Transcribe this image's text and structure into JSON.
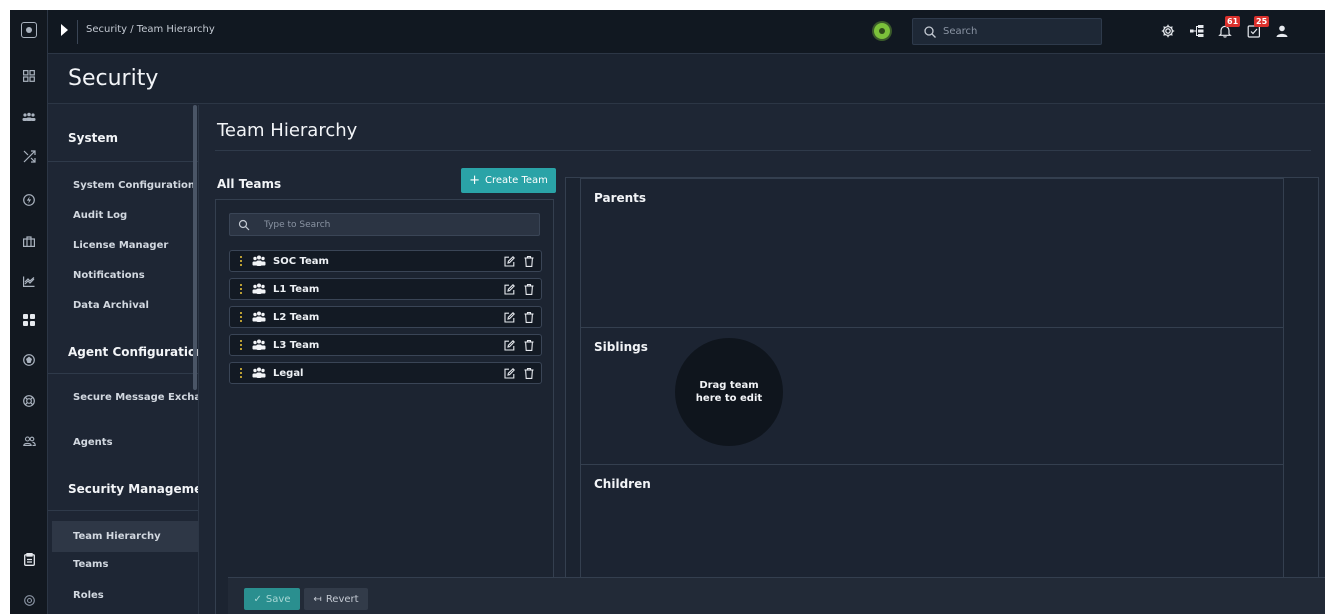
{
  "breadcrumb": {
    "text": "Security / Team Hierarchy"
  },
  "topbar": {
    "search_placeholder": "Search",
    "notifications_count": "61",
    "tasks_count": "25"
  },
  "page": {
    "title": "Security"
  },
  "sidebar": {
    "sections": [
      {
        "heading": "System",
        "items": [
          "System Configuration",
          "Audit Log",
          "License Manager",
          "Notifications",
          "Data Archival"
        ]
      },
      {
        "heading": "Agent Configurations",
        "items": [
          "Secure Message Exchange",
          "Agents"
        ]
      },
      {
        "heading": "Security Management",
        "items": [
          "Team Hierarchy",
          "Teams",
          "Roles"
        ]
      }
    ],
    "active_item": "Team Hierarchy"
  },
  "main": {
    "title": "Team Hierarchy",
    "all_teams_label": "All Teams",
    "create_team_label": "Create Team",
    "team_search_placeholder": "Type to Search",
    "teams": [
      "SOC Team",
      "L1 Team",
      "L2 Team",
      "L3 Team",
      "Legal"
    ]
  },
  "hierarchy": {
    "parents_label": "Parents",
    "siblings_label": "Siblings",
    "children_label": "Children",
    "drop_hint_line1": "Drag team",
    "drop_hint_line2": "here to edit"
  },
  "footer": {
    "save_label": "Save",
    "revert_label": "Revert"
  },
  "colors": {
    "accent": "#2aa3a7",
    "background": "#1e2634",
    "topbar": "#111821",
    "badge": "#d9302c",
    "status": "#7bc13a"
  },
  "icons": {
    "rail": [
      "dashboard-icon",
      "people-group-icon",
      "shuffle-icon",
      "bolt-icon",
      "briefcase-icon",
      "chart-icon",
      "apps-grid-icon",
      "shield-icon",
      "lifebuoy-icon",
      "users-icon",
      "clipboard-icon",
      "at-icon"
    ],
    "topbar": [
      "settings-icon",
      "hierarchy-icon",
      "bell-icon",
      "tasks-icon",
      "user-icon"
    ]
  }
}
